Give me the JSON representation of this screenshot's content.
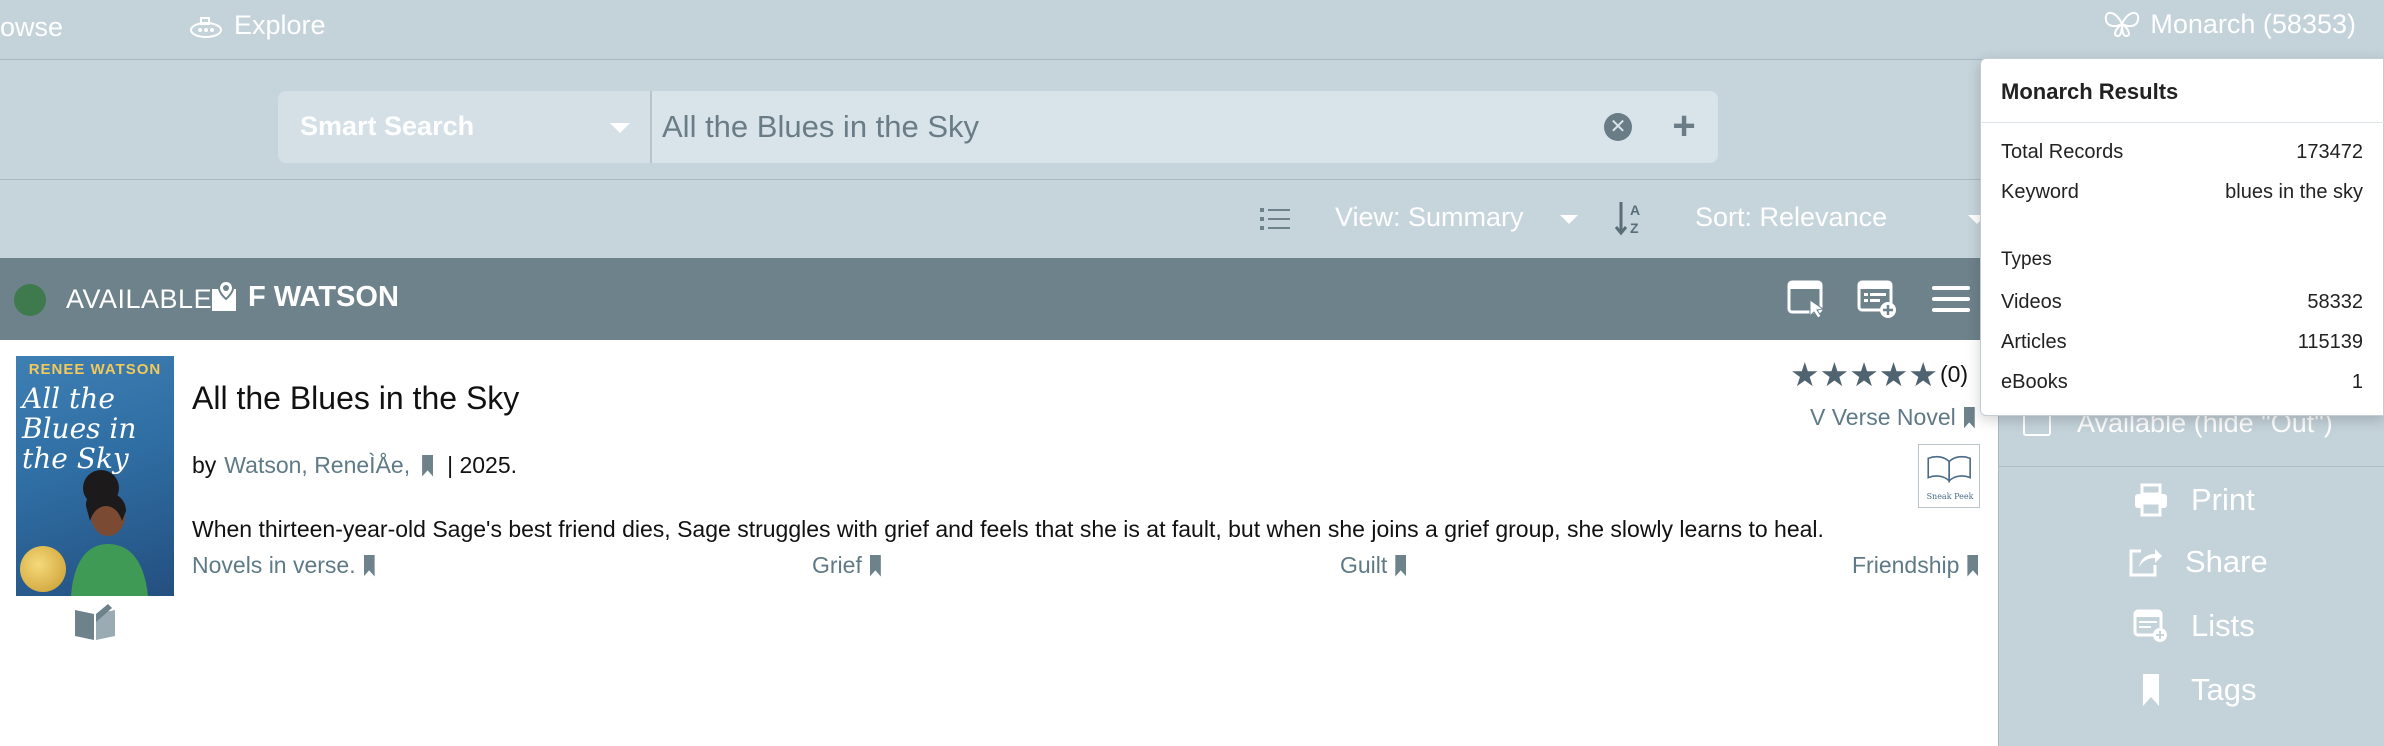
{
  "topnav": {
    "browse_label": "owse",
    "explore_label": "Explore",
    "monarch_label": "Monarch (58353)"
  },
  "search": {
    "type_label": "Smart Search",
    "query": "All the Blues in the Sky",
    "clear_glyph": "✕",
    "add_glyph": "+"
  },
  "toolbar": {
    "view_label": "View: Summary",
    "sort_label": "Sort: Relevance"
  },
  "availability": {
    "status": "AVAILABLE",
    "call_number": "F WATSON",
    "status_color": "#3f7a4e"
  },
  "record": {
    "cover_author": "RENEE WATSON",
    "cover_title": "All the Blues in the Sky",
    "title": "All the Blues in the Sky",
    "by_prefix": "by",
    "author": "Watson, ReneÌÅe,",
    "year": "| 2025.",
    "description": "When thirteen-year-old Sage's best friend dies, Sage struggles with grief and feels that she is at fault, but when she joins a grief group, she slowly learns to heal.",
    "subjects": [
      "Novels in verse.",
      "Grief",
      "Guilt",
      "Friendship"
    ],
    "rating_count": "(0)",
    "rating_stars": 0,
    "genre": "V Verse Novel",
    "sneak_peek_label": "Sneak Peek"
  },
  "right_panel": {
    "available_filter": "Available (hide \"Out\")",
    "actions": [
      "Print",
      "Share",
      "Lists",
      "Tags"
    ]
  },
  "monarch_popup": {
    "title": "Monarch Results",
    "total_label": "Total Records",
    "total_value": "173472",
    "keyword_label": "Keyword",
    "keyword_value": "blues in the sky",
    "types_heading": "Types",
    "types": [
      {
        "label": "Videos",
        "value": "58332"
      },
      {
        "label": "Articles",
        "value": "115139"
      },
      {
        "label": "eBooks",
        "value": "1"
      }
    ]
  },
  "colors": {
    "nav_bg": "#c4d2da",
    "avail_bar": "#6e828c",
    "link": "#5f7a86"
  }
}
